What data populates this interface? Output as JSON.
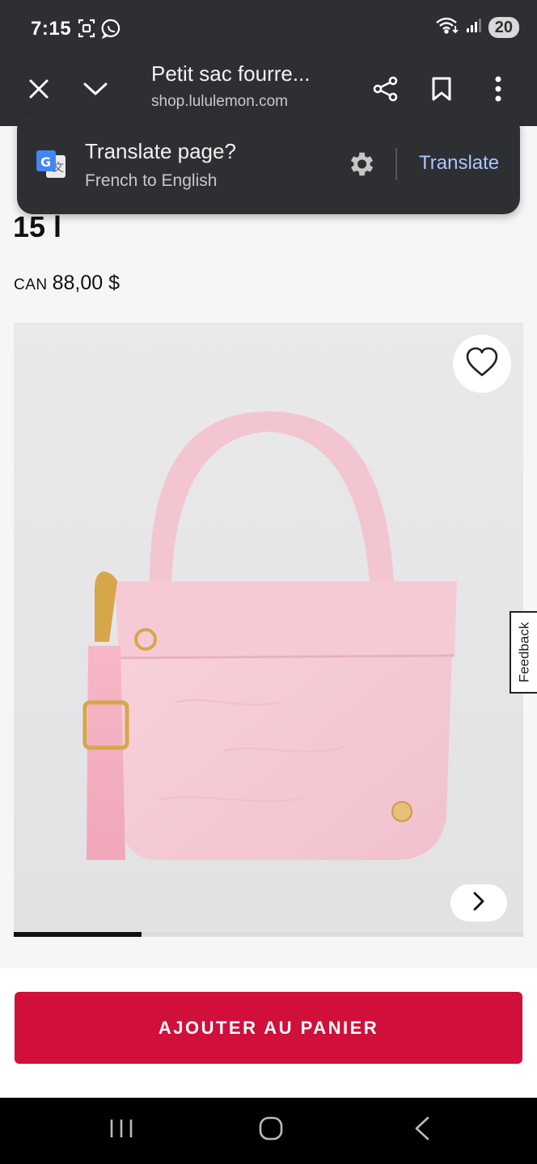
{
  "status_bar": {
    "time": "7:15",
    "battery": "20"
  },
  "toolbar": {
    "title": "Petit sac fourre...",
    "url": "shop.lululemon.com",
    "icons": [
      "close-icon",
      "chevron-down-icon",
      "share-icon",
      "bookmark-icon",
      "more-vert-icon"
    ]
  },
  "translate_popup": {
    "title": "Translate page?",
    "subtitle": "French to English",
    "action": "Translate"
  },
  "product": {
    "title_partial": "15 l",
    "currency": "CAN",
    "price": "88,00 $",
    "image_progress": 0.25
  },
  "feedback": {
    "label": "Feedback"
  },
  "cart": {
    "button_label": "AJOUTER AU PANIER"
  },
  "colors": {
    "accent": "#d0103a",
    "chrome": "#2d2f33",
    "link": "#a8c7fa"
  }
}
